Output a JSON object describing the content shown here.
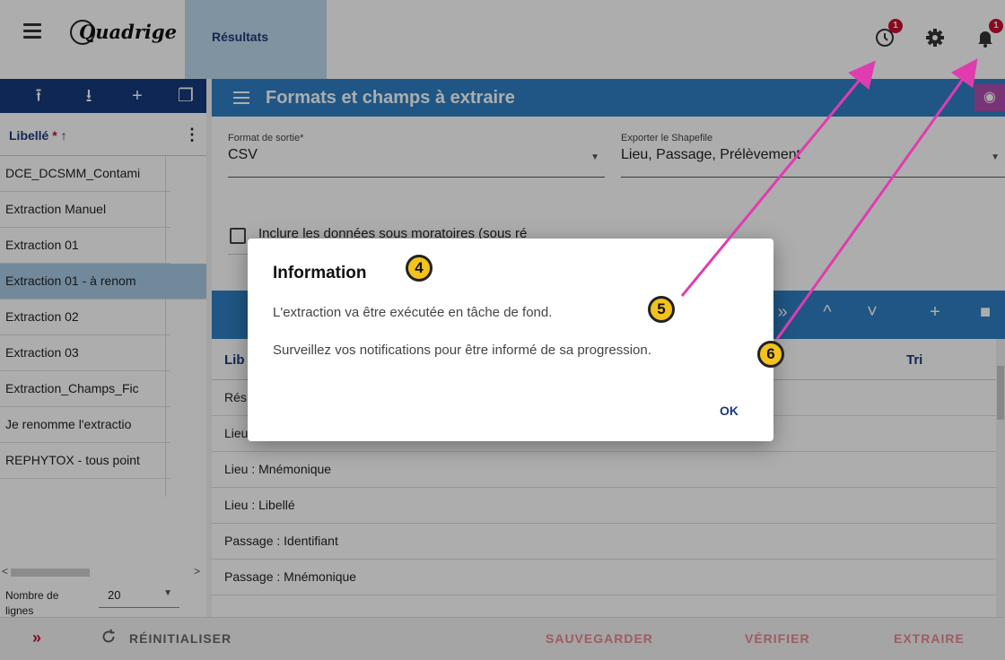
{
  "app": {
    "logo_text": "Quadrige"
  },
  "header": {
    "tab_results": "Résultats",
    "history_badge": "1",
    "notif_badge": "1"
  },
  "sidebar": {
    "column_label": "Libellé",
    "required_mark": "*",
    "sort_arrow": "↑",
    "items": [
      {
        "label": "DCE_DCSMM_Contami"
      },
      {
        "label": "Extraction Manuel"
      },
      {
        "label": "Extraction 01"
      },
      {
        "label": "Extraction 01 - à renom"
      },
      {
        "label": "Extraction 02"
      },
      {
        "label": "Extraction 03"
      },
      {
        "label": "Extraction_Champs_Fic"
      },
      {
        "label": "Je renomme l'extractio"
      },
      {
        "label": "REPHYTOX - tous point"
      }
    ],
    "rows_label": "Nombre de lignes",
    "rows_value": "20"
  },
  "main": {
    "title": "Formats et champs à extraire",
    "output_format": {
      "label": "Format de sortie*",
      "value": "CSV"
    },
    "shapefile": {
      "label": "Exporter le Shapefile",
      "value": "Lieu, Passage, Prélèvement"
    },
    "include_moratoria": "Inclure les données sous moratoires (sous ré",
    "col_libelle": "Lib",
    "col_tri": "Tri",
    "rows": [
      {
        "label": "Rés"
      },
      {
        "label": "Lieu : Identifiant"
      },
      {
        "label": "Lieu : Mnémonique"
      },
      {
        "label": "Lieu : Libellé"
      },
      {
        "label": "Passage : Identifiant"
      },
      {
        "label": "Passage : Mnémonique"
      }
    ]
  },
  "actions": {
    "expand": "»",
    "reset": "RÉINITIALISER",
    "save": "SAUVEGARDER",
    "verify": "VÉRIFIER",
    "extract": "EXTRAIRE"
  },
  "dialog": {
    "title": "Information",
    "line1": "L'extraction va être exécutée en tâche de fond.",
    "line2": "Surveillez vos notifications pour être informé de sa progression.",
    "ok": "OK"
  },
  "callouts": {
    "c4": "4",
    "c5": "5",
    "c6": "6"
  },
  "colors": {
    "primary": "#2e7fc4",
    "dark_blue": "#163a7c",
    "accent_red": "#c8102e",
    "arrow": "#e03cb0",
    "callout": "#f4c21d"
  }
}
